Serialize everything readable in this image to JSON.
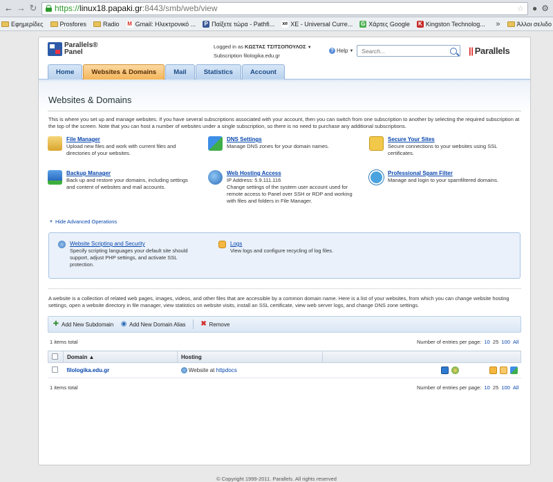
{
  "browser": {
    "url_scheme": "https://",
    "url_host": "linux18.papaki.gr",
    "url_rest": ":8443/smb/web/view",
    "bookmarks": [
      {
        "label": "Εφημερίδες",
        "type": "folder"
      },
      {
        "label": "Prosfores",
        "type": "folder"
      },
      {
        "label": "Radio",
        "type": "folder"
      },
      {
        "label": "Gmail: Ηλεκτρονικό ...",
        "type": "site",
        "color": "#d93025",
        "glyph": "M"
      },
      {
        "label": "Παίξετε τώρα - Pathfi...",
        "type": "site",
        "color": "#3b5998",
        "glyph": "P"
      },
      {
        "label": "XE - Universal Curre...",
        "type": "site",
        "color": "#1a1a1a",
        "glyph": "xe"
      },
      {
        "label": "Χάρτες Google",
        "type": "site",
        "color": "#4caf50",
        "glyph": "G"
      },
      {
        "label": "Kingston Technolog...",
        "type": "site",
        "color": "#c62828",
        "glyph": "K"
      }
    ],
    "other_bookmarks": "Άλλοι σελιδο"
  },
  "header": {
    "logo_line1": "Parallels®",
    "logo_line2": "Panel",
    "logged_in_prefix": "Logged in as",
    "user_name": "ΚΩΣΤΑΣ ΤΣΙΤΣΟΠΟΥΛΟΣ",
    "subscription_prefix": "Subscription",
    "subscription": "filologika.edu.gr",
    "help_label": "Help",
    "search_placeholder": "Search...",
    "brand": "Parallels"
  },
  "tabs": [
    {
      "label": "Home",
      "active": false
    },
    {
      "label": "Websites & Domains",
      "active": true
    },
    {
      "label": "Mail",
      "active": false
    },
    {
      "label": "Statistics",
      "active": false
    },
    {
      "label": "Account",
      "active": false
    }
  ],
  "page": {
    "title": "Websites & Domains",
    "intro": "This is where you set up and manage websites. If you have several subscriptions associated with your account, then you can switch from one subscription to another by selecting the required subscription at the top of the screen. Note that you can host a number of websites under a single subscription, so there is no need to purchase any additional subscriptions."
  },
  "tools": [
    {
      "title": "File Manager",
      "desc": "Upload new files and work with current files and directories of your websites.",
      "icon": "folder-icon"
    },
    {
      "title": "DNS Settings",
      "desc": "Manage DNS zones for your domain names.",
      "icon": "dns-flag-icon"
    },
    {
      "title": "Secure Your Sites",
      "desc": "Secure connections to your websites using SSL certificates.",
      "icon": "certificate-icon"
    },
    {
      "title": "Backup Manager",
      "desc": "Back up and restore your domains, including settings and content of websites and mail accounts.",
      "icon": "backup-icon"
    },
    {
      "title": "Web Hosting Access",
      "desc": "IP Address: 5.9.111.116\nChange settings of the system user account used for remote access to Panel over SSH or RDP and working with files and folders in File Manager.",
      "icon": "globe-user-icon"
    },
    {
      "title": "Professional Spam Filter",
      "desc": "Manage and login to your spamfiltered domains.",
      "icon": "spam-filter-icon"
    }
  ],
  "advanced": {
    "toggle_label": "Hide Advanced Operations",
    "items": [
      {
        "title": "Website Scripting and Security",
        "desc": "Specify scripting languages your default site should support, adjust PHP settings, and activate SSL protection.",
        "icon": "gear-script-icon"
      },
      {
        "title": "Logs",
        "desc": "View logs and configure recycling of log files.",
        "icon": "logs-icon"
      }
    ]
  },
  "sites": {
    "intro": "A website is a collection of related web pages, images, videos, and other files that are accessible by a common domain name. Here is a list of your websites, from which you can change website hosting settings, open a website directory in file manager, view statistics on website visits, install an SSL certificate, view web server logs, and change DNS zone settings.",
    "toolbar": {
      "add_subdomain": "Add New Subdomain",
      "add_alias": "Add New Domain Alias",
      "remove": "Remove"
    },
    "items_total": "1 items total",
    "entries_label": "Number of entries per page:",
    "page_sizes": [
      "10",
      "25",
      "100",
      "All"
    ],
    "columns": {
      "domain": "Domain ▲",
      "hosting": "Hosting"
    },
    "rows": [
      {
        "domain": "filologika.edu.gr",
        "hosting_prefix": "Website at",
        "hosting_link": "httpdocs"
      }
    ]
  },
  "footer": "© Copyright 1999-2011. Parallels. All rights reserved"
}
